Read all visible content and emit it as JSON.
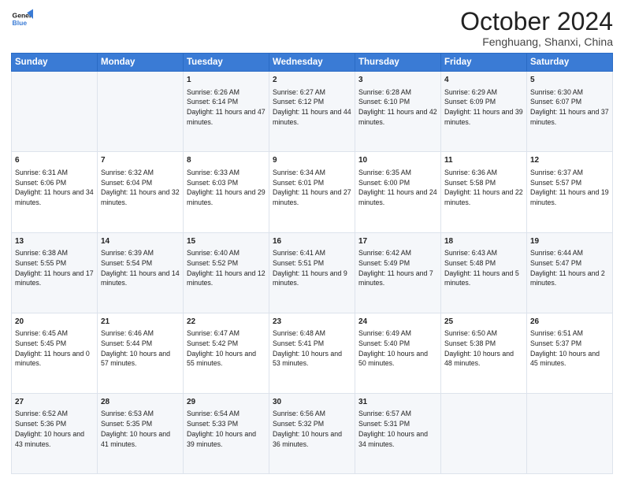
{
  "header": {
    "logo_line1": "General",
    "logo_line2": "Blue",
    "month": "October 2024",
    "location": "Fenghuang, Shanxi, China"
  },
  "days_of_week": [
    "Sunday",
    "Monday",
    "Tuesday",
    "Wednesday",
    "Thursday",
    "Friday",
    "Saturday"
  ],
  "weeks": [
    [
      {
        "day": "",
        "sunrise": "",
        "sunset": "",
        "daylight": ""
      },
      {
        "day": "",
        "sunrise": "",
        "sunset": "",
        "daylight": ""
      },
      {
        "day": "1",
        "sunrise": "Sunrise: 6:26 AM",
        "sunset": "Sunset: 6:14 PM",
        "daylight": "Daylight: 11 hours and 47 minutes."
      },
      {
        "day": "2",
        "sunrise": "Sunrise: 6:27 AM",
        "sunset": "Sunset: 6:12 PM",
        "daylight": "Daylight: 11 hours and 44 minutes."
      },
      {
        "day": "3",
        "sunrise": "Sunrise: 6:28 AM",
        "sunset": "Sunset: 6:10 PM",
        "daylight": "Daylight: 11 hours and 42 minutes."
      },
      {
        "day": "4",
        "sunrise": "Sunrise: 6:29 AM",
        "sunset": "Sunset: 6:09 PM",
        "daylight": "Daylight: 11 hours and 39 minutes."
      },
      {
        "day": "5",
        "sunrise": "Sunrise: 6:30 AM",
        "sunset": "Sunset: 6:07 PM",
        "daylight": "Daylight: 11 hours and 37 minutes."
      }
    ],
    [
      {
        "day": "6",
        "sunrise": "Sunrise: 6:31 AM",
        "sunset": "Sunset: 6:06 PM",
        "daylight": "Daylight: 11 hours and 34 minutes."
      },
      {
        "day": "7",
        "sunrise": "Sunrise: 6:32 AM",
        "sunset": "Sunset: 6:04 PM",
        "daylight": "Daylight: 11 hours and 32 minutes."
      },
      {
        "day": "8",
        "sunrise": "Sunrise: 6:33 AM",
        "sunset": "Sunset: 6:03 PM",
        "daylight": "Daylight: 11 hours and 29 minutes."
      },
      {
        "day": "9",
        "sunrise": "Sunrise: 6:34 AM",
        "sunset": "Sunset: 6:01 PM",
        "daylight": "Daylight: 11 hours and 27 minutes."
      },
      {
        "day": "10",
        "sunrise": "Sunrise: 6:35 AM",
        "sunset": "Sunset: 6:00 PM",
        "daylight": "Daylight: 11 hours and 24 minutes."
      },
      {
        "day": "11",
        "sunrise": "Sunrise: 6:36 AM",
        "sunset": "Sunset: 5:58 PM",
        "daylight": "Daylight: 11 hours and 22 minutes."
      },
      {
        "day": "12",
        "sunrise": "Sunrise: 6:37 AM",
        "sunset": "Sunset: 5:57 PM",
        "daylight": "Daylight: 11 hours and 19 minutes."
      }
    ],
    [
      {
        "day": "13",
        "sunrise": "Sunrise: 6:38 AM",
        "sunset": "Sunset: 5:55 PM",
        "daylight": "Daylight: 11 hours and 17 minutes."
      },
      {
        "day": "14",
        "sunrise": "Sunrise: 6:39 AM",
        "sunset": "Sunset: 5:54 PM",
        "daylight": "Daylight: 11 hours and 14 minutes."
      },
      {
        "day": "15",
        "sunrise": "Sunrise: 6:40 AM",
        "sunset": "Sunset: 5:52 PM",
        "daylight": "Daylight: 11 hours and 12 minutes."
      },
      {
        "day": "16",
        "sunrise": "Sunrise: 6:41 AM",
        "sunset": "Sunset: 5:51 PM",
        "daylight": "Daylight: 11 hours and 9 minutes."
      },
      {
        "day": "17",
        "sunrise": "Sunrise: 6:42 AM",
        "sunset": "Sunset: 5:49 PM",
        "daylight": "Daylight: 11 hours and 7 minutes."
      },
      {
        "day": "18",
        "sunrise": "Sunrise: 6:43 AM",
        "sunset": "Sunset: 5:48 PM",
        "daylight": "Daylight: 11 hours and 5 minutes."
      },
      {
        "day": "19",
        "sunrise": "Sunrise: 6:44 AM",
        "sunset": "Sunset: 5:47 PM",
        "daylight": "Daylight: 11 hours and 2 minutes."
      }
    ],
    [
      {
        "day": "20",
        "sunrise": "Sunrise: 6:45 AM",
        "sunset": "Sunset: 5:45 PM",
        "daylight": "Daylight: 11 hours and 0 minutes."
      },
      {
        "day": "21",
        "sunrise": "Sunrise: 6:46 AM",
        "sunset": "Sunset: 5:44 PM",
        "daylight": "Daylight: 10 hours and 57 minutes."
      },
      {
        "day": "22",
        "sunrise": "Sunrise: 6:47 AM",
        "sunset": "Sunset: 5:42 PM",
        "daylight": "Daylight: 10 hours and 55 minutes."
      },
      {
        "day": "23",
        "sunrise": "Sunrise: 6:48 AM",
        "sunset": "Sunset: 5:41 PM",
        "daylight": "Daylight: 10 hours and 53 minutes."
      },
      {
        "day": "24",
        "sunrise": "Sunrise: 6:49 AM",
        "sunset": "Sunset: 5:40 PM",
        "daylight": "Daylight: 10 hours and 50 minutes."
      },
      {
        "day": "25",
        "sunrise": "Sunrise: 6:50 AM",
        "sunset": "Sunset: 5:38 PM",
        "daylight": "Daylight: 10 hours and 48 minutes."
      },
      {
        "day": "26",
        "sunrise": "Sunrise: 6:51 AM",
        "sunset": "Sunset: 5:37 PM",
        "daylight": "Daylight: 10 hours and 45 minutes."
      }
    ],
    [
      {
        "day": "27",
        "sunrise": "Sunrise: 6:52 AM",
        "sunset": "Sunset: 5:36 PM",
        "daylight": "Daylight: 10 hours and 43 minutes."
      },
      {
        "day": "28",
        "sunrise": "Sunrise: 6:53 AM",
        "sunset": "Sunset: 5:35 PM",
        "daylight": "Daylight: 10 hours and 41 minutes."
      },
      {
        "day": "29",
        "sunrise": "Sunrise: 6:54 AM",
        "sunset": "Sunset: 5:33 PM",
        "daylight": "Daylight: 10 hours and 39 minutes."
      },
      {
        "day": "30",
        "sunrise": "Sunrise: 6:56 AM",
        "sunset": "Sunset: 5:32 PM",
        "daylight": "Daylight: 10 hours and 36 minutes."
      },
      {
        "day": "31",
        "sunrise": "Sunrise: 6:57 AM",
        "sunset": "Sunset: 5:31 PM",
        "daylight": "Daylight: 10 hours and 34 minutes."
      },
      {
        "day": "",
        "sunrise": "",
        "sunset": "",
        "daylight": ""
      },
      {
        "day": "",
        "sunrise": "",
        "sunset": "",
        "daylight": ""
      }
    ]
  ]
}
